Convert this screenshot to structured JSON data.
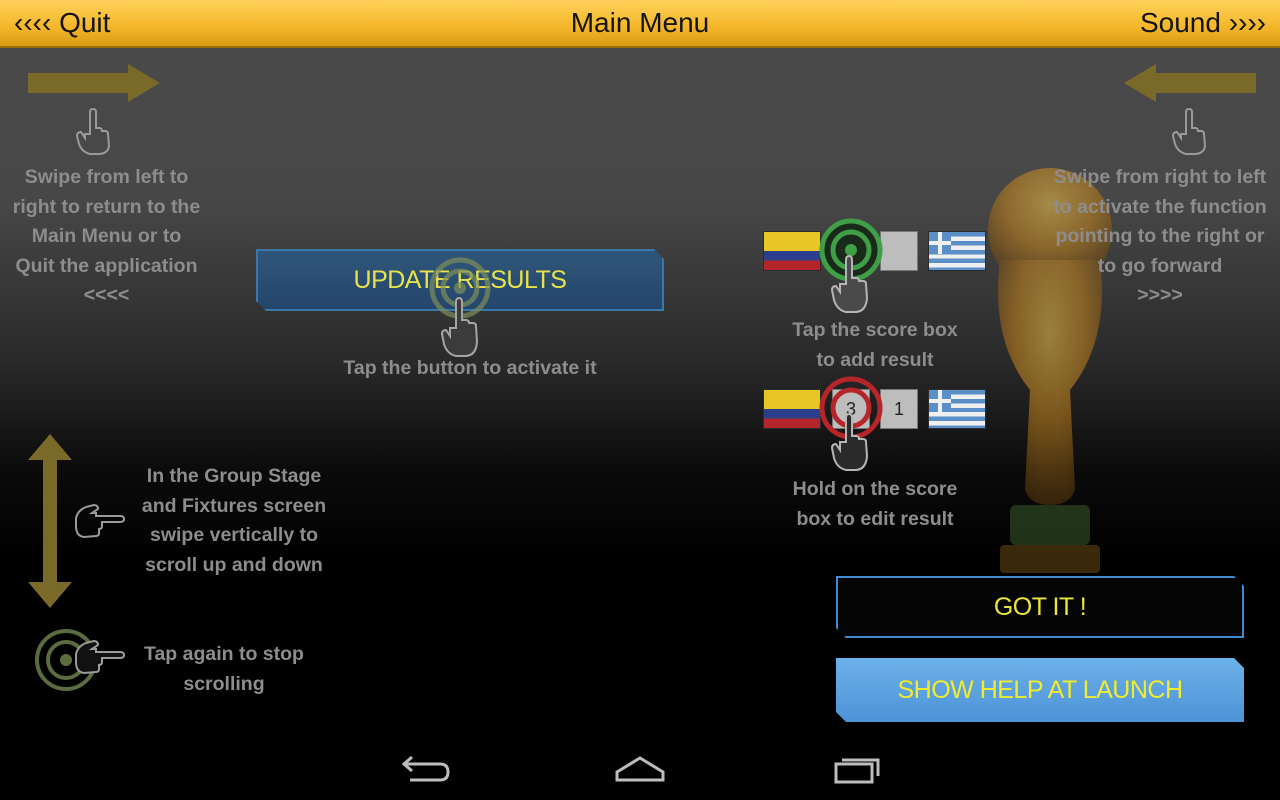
{
  "header": {
    "quit_label": "‹‹‹‹ Quit",
    "title": "Main Menu",
    "sound_label": "Sound ››››"
  },
  "hints": {
    "swipe_left_to_right": [
      "Swipe from left to",
      "right to return to the",
      "Main Menu or to",
      "Quit the application",
      "<<<<"
    ],
    "swipe_right_to_left": [
      "Swipe from right to left",
      "to activate the function",
      "pointing to the right or",
      "to go forward",
      ">>>>"
    ],
    "tap_button": "Tap the button to activate it",
    "tap_score_box": [
      "Tap the score box",
      "to add result"
    ],
    "hold_score_box": [
      "Hold on the score",
      "box to edit result"
    ],
    "vertical_swipe": [
      "In the Group Stage",
      "and Fixtures screen",
      "swipe vertically to",
      "scroll up and down"
    ],
    "tap_again": [
      "Tap again to stop",
      "scrolling"
    ]
  },
  "buttons": {
    "update_results": "UPDATE RESULTS",
    "got_it": "GOT IT !",
    "show_help": "SHOW HELP AT LAUNCH"
  },
  "score_examples": {
    "add": {
      "team1_flag": "colombia-flag",
      "score1": "",
      "score2": "",
      "team2_flag": "greece-flag"
    },
    "edit": {
      "team1_flag": "colombia-flag",
      "score1": "3",
      "score2": "1",
      "team2_flag": "greece-flag"
    }
  },
  "colors": {
    "header_bar": "#f4b629",
    "button_text_yellow": "#e8e24a",
    "button_blue": "#4d93d6",
    "hint_gray": "#8d8d8d"
  },
  "icons": [
    "hand-pointer-icon",
    "arrow-right-icon",
    "arrow-left-icon",
    "double-arrow-vertical-icon",
    "tap-target-icon",
    "trophy-icon",
    "back-icon",
    "home-icon",
    "recents-icon"
  ],
  "navigation": {
    "back": "back",
    "home": "home",
    "recents": "recents"
  }
}
